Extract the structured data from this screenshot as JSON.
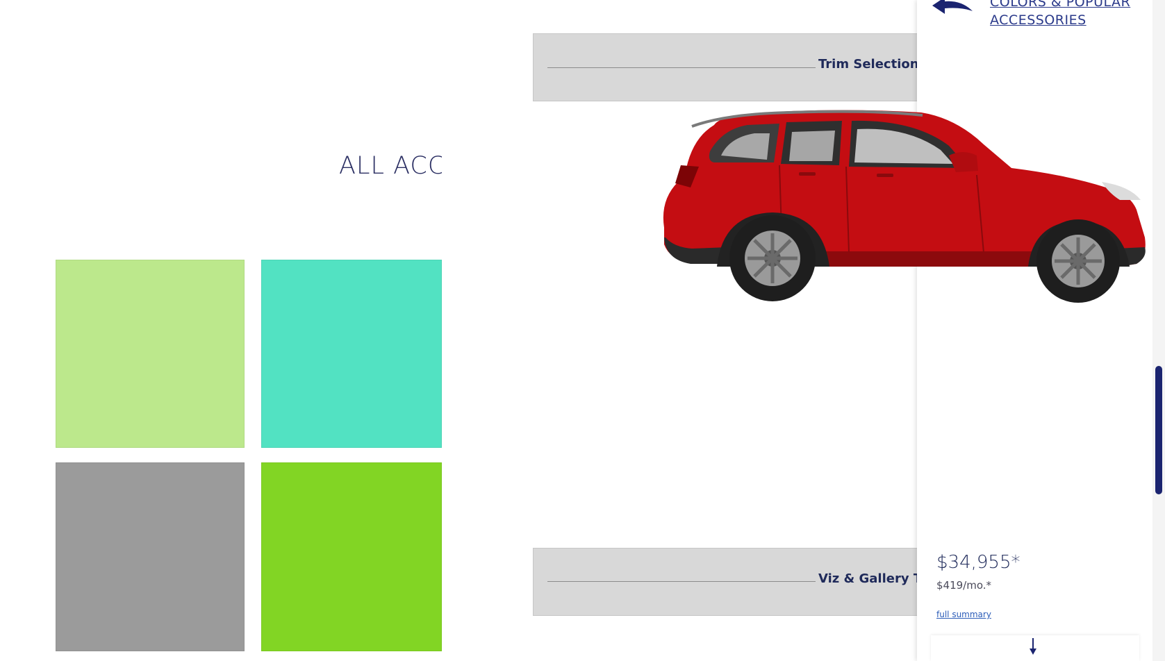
{
  "main": {
    "section_title": "ALL ACC",
    "swatches": [
      {
        "color": "#bce88c"
      },
      {
        "color": "#52e2c2"
      },
      {
        "color": "#9b9b9b"
      },
      {
        "color": "#82d524"
      }
    ],
    "placeholders": {
      "trim_selection": "Trim Selection",
      "viz_gallery": "Viz & Gallery T"
    },
    "vehicle": {
      "icon": "red-suv-image",
      "body_color": "#c40d12"
    }
  },
  "summary_panel": {
    "back_link_label": "COLORS & POPULAR ACCESSORIES",
    "price": "$34,955*",
    "monthly": "$419/mo.*",
    "full_summary_label": "full summary"
  },
  "colors": {
    "accent": "#1b2470",
    "link": "#2b5cb8",
    "placeholder_bg": "#d8d8d8"
  }
}
